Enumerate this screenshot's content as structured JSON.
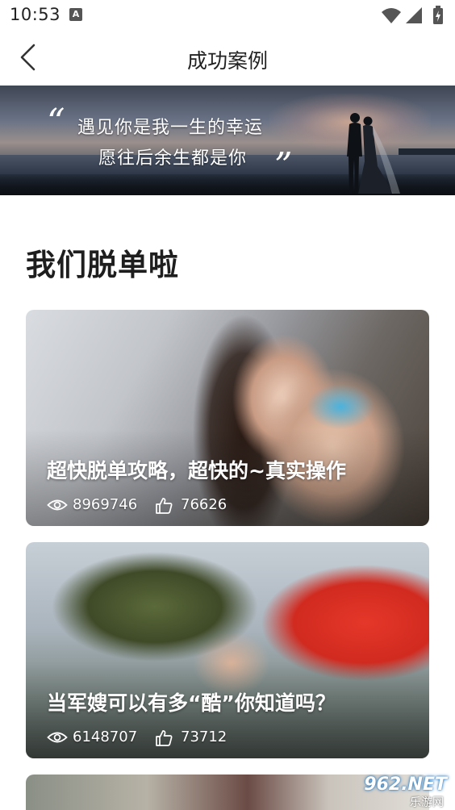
{
  "status_bar": {
    "time": "10:53",
    "notification_letter": "A"
  },
  "header": {
    "title": "成功案例"
  },
  "banner": {
    "line1": "遇见你是我一生的幸运",
    "line2": "愿往后余生都是你",
    "quote_open": "“",
    "quote_close": "”"
  },
  "section": {
    "title": "我们脱单啦"
  },
  "cases": [
    {
      "title": "超快脱单攻略，超快的~真实操作",
      "views": "8969746",
      "likes": "76626"
    },
    {
      "title": "当军嫂可以有多“酷”你知道吗？",
      "views": "6148707",
      "likes": "73712"
    }
  ],
  "watermark": {
    "top": "962.NET",
    "bottom": "乐游网"
  },
  "colors": {
    "text": "#222222",
    "card_text": "#ffffff",
    "background": "#ffffff"
  }
}
